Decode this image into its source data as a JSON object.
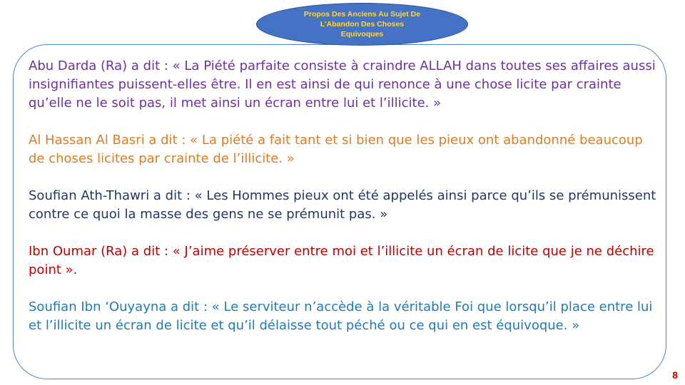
{
  "title": {
    "lines": [
      "Propos Des Anciens Au Sujet De",
      "L’Abandon Des Choses",
      "Equivoques"
    ],
    "background": "#4472c4",
    "text_color": "#ffd54a"
  },
  "quotes": [
    {
      "text": "Abu Darda (Ra) a dit : « La Piété parfaite consiste à craindre ALLAH dans toutes ses affaires aussi insignifiantes puissent-elles être. Il en est ainsi de qui renonce à une chose licite par crainte qu’elle ne le soit pas, il met ainsi un écran entre lui et l’illicite. »",
      "color": "#7030a0"
    },
    {
      "text": "Al Hassan Al Basri a dit : « La piété a fait tant et si bien que les pieux ont abandonné beaucoup de choses licites par crainte de l’illicite. »",
      "color": "#e07b22"
    },
    {
      "text": "Soufian Ath-Thawri a dit : « Les Hommes pieux ont été appelés ainsi parce qu’ils se prémunissent contre ce quoi la masse des gens ne se prémunit pas. »",
      "color": "#1f3864"
    },
    {
      "text": "Ibn Oumar (Ra) a dit : « J’aime préserver entre moi et l’illicite un écran de licite que je ne déchire point ».",
      "color": "#c00000"
    },
    {
      "text": "Soufian Ibn ‘Ouyayna a dit : « Le serviteur n’accède à la véritable Foi que lorsqu’il place entre lui et l’illicite un écran de licite et qu’il délaisse tout péché ou ce qui en est équivoque. »",
      "color": "#1f7ab8"
    }
  ],
  "page_number": "8"
}
